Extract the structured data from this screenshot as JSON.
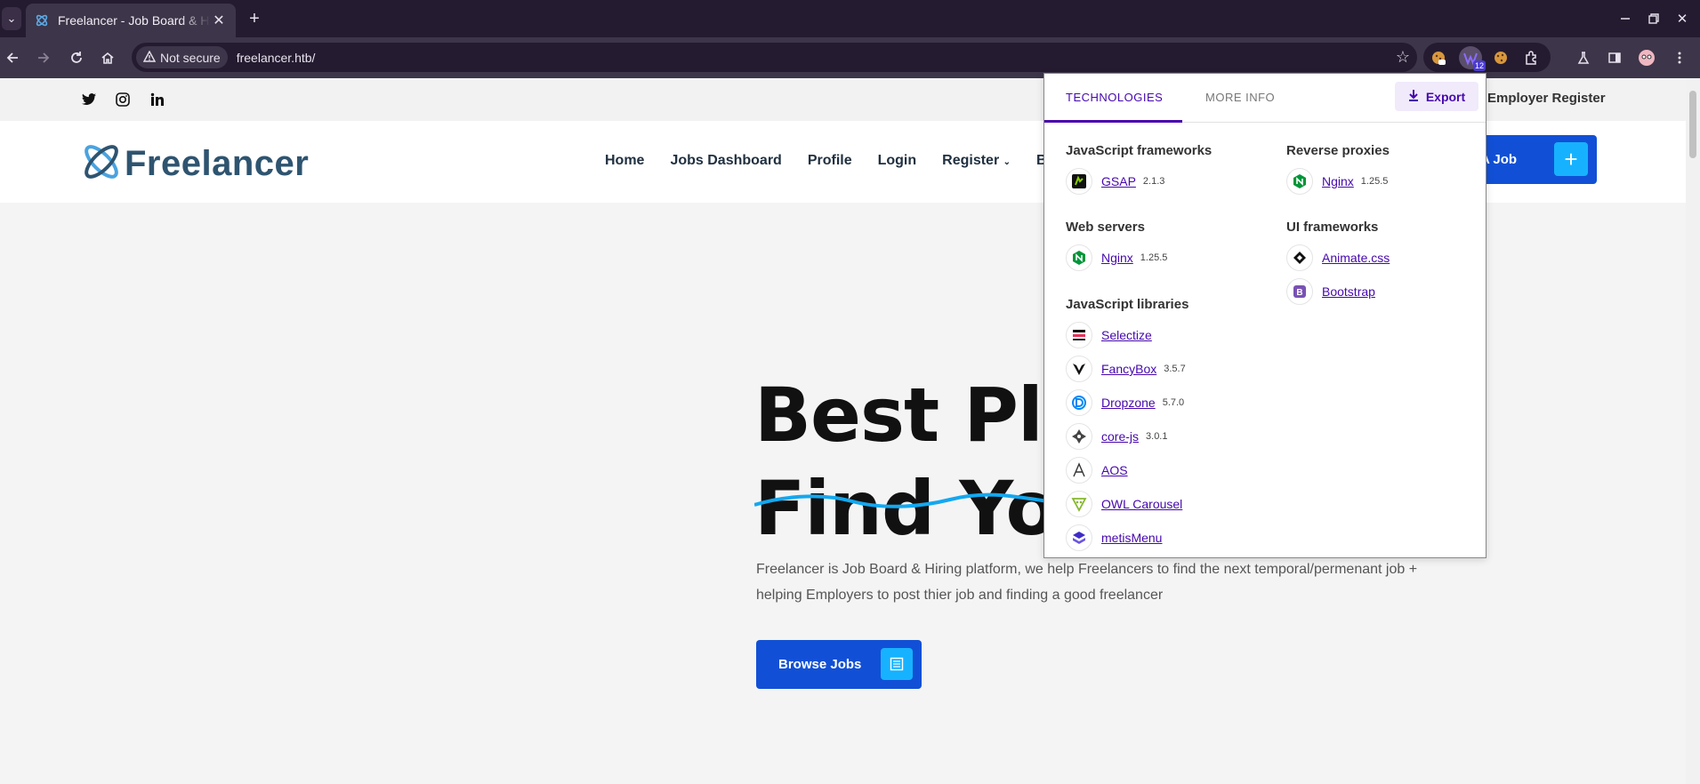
{
  "browser": {
    "tab_title": "Freelancer - Job Board & Hiring platform",
    "security_label": "Not secure",
    "url": "freelancer.htb/",
    "extension_badge": "12"
  },
  "site": {
    "logo_text": "Freelancer",
    "employer_register": "Employer Register",
    "nav": [
      "Home",
      "Jobs Dashboard",
      "Profile",
      "Login",
      "Register",
      "Blog"
    ],
    "post_job_label": "st A Job",
    "hero_line1": "Best Plat",
    "hero_line2": "Find You",
    "hero_description": "Freelancer is Job Board & Hiring platform, we help Freelancers to find the next temporal/permenant job + helping Employers to post thier job and finding a good freelancer",
    "browse_jobs_label": "Browse Jobs",
    "colors": {
      "primary": "#1150d6",
      "accent": "#17b2ff",
      "logo": "#2e5470"
    }
  },
  "wappalyzer": {
    "tabs": [
      "TECHNOLOGIES",
      "MORE INFO"
    ],
    "export_label": "Export",
    "accent_color": "#4608ad",
    "left_column": [
      {
        "category": "JavaScript frameworks",
        "items": [
          {
            "name": "GSAP",
            "version": "2.1.3",
            "icon": "gsap-icon"
          }
        ]
      },
      {
        "category": "Web servers",
        "items": [
          {
            "name": "Nginx",
            "version": "1.25.5",
            "icon": "nginx-icon"
          }
        ]
      },
      {
        "category": "JavaScript libraries",
        "items": [
          {
            "name": "Selectize",
            "version": "",
            "icon": "selectize-icon"
          },
          {
            "name": "FancyBox",
            "version": "3.5.7",
            "icon": "fancybox-icon"
          },
          {
            "name": "Dropzone",
            "version": "5.7.0",
            "icon": "dropzone-icon"
          },
          {
            "name": "core-js",
            "version": "3.0.1",
            "icon": "core-js-icon"
          },
          {
            "name": "AOS",
            "version": "",
            "icon": "aos-icon"
          },
          {
            "name": "OWL Carousel",
            "version": "",
            "icon": "owl-carousel-icon"
          },
          {
            "name": "metisMenu",
            "version": "",
            "icon": "metismenu-icon"
          }
        ]
      }
    ],
    "right_column": [
      {
        "category": "Reverse proxies",
        "items": [
          {
            "name": "Nginx",
            "version": "1.25.5",
            "icon": "nginx-icon"
          }
        ]
      },
      {
        "category": "UI frameworks",
        "items": [
          {
            "name": "Animate.css",
            "version": "",
            "icon": "animate-css-icon"
          },
          {
            "name": "Bootstrap",
            "version": "",
            "icon": "bootstrap-icon"
          }
        ]
      }
    ]
  }
}
